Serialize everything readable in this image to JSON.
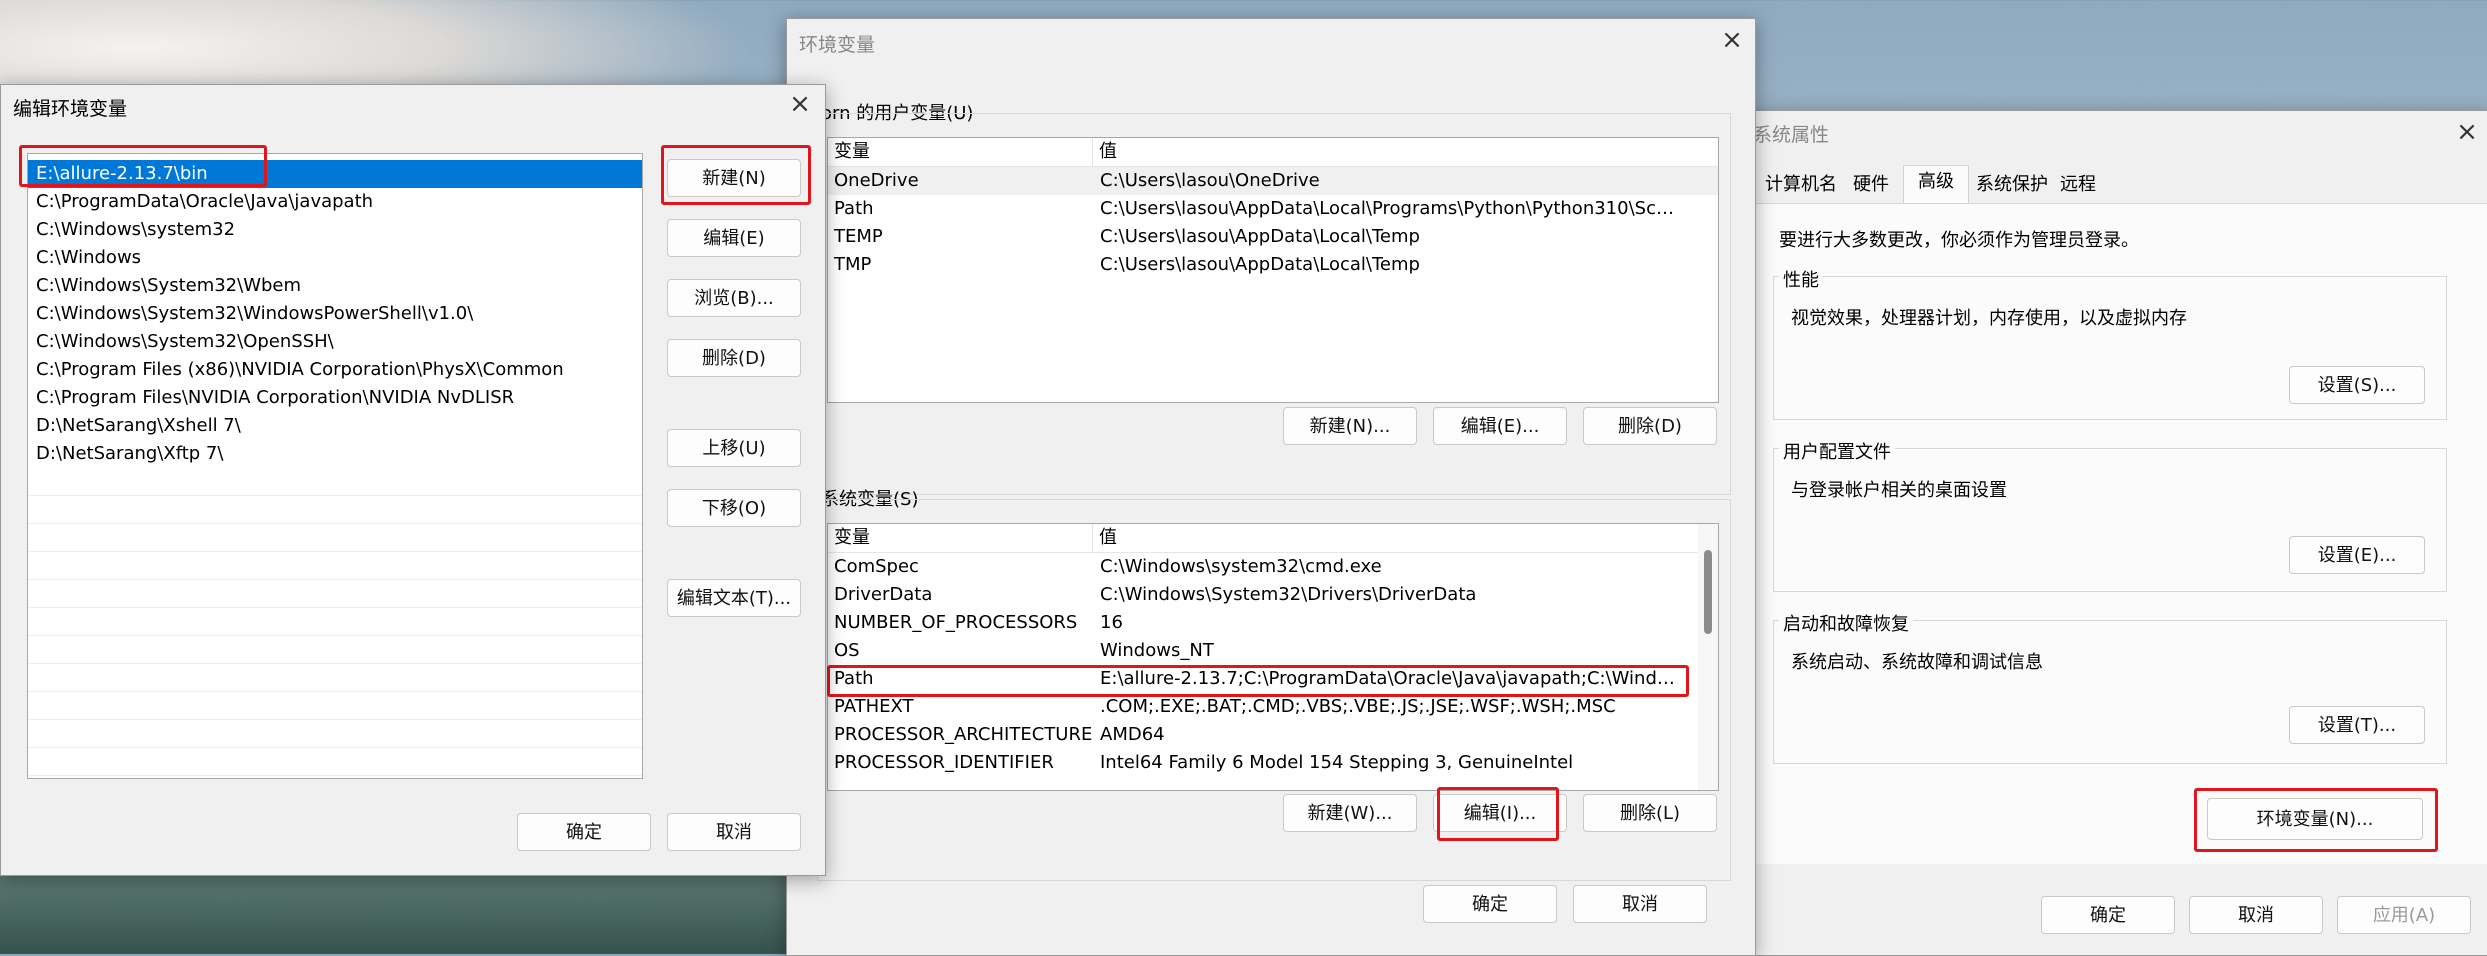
{
  "sysprops": {
    "title": "系统属性",
    "tabs": [
      "计算机名",
      "硬件",
      "高级",
      "系统保护",
      "远程"
    ],
    "admin_note": "要进行大多数更改，你必须作为管理员登录。",
    "performance": {
      "label": "性能",
      "desc": "视觉效果，处理器计划，内存使用，以及虚拟内存",
      "button": "设置(S)..."
    },
    "profiles": {
      "label": "用户配置文件",
      "desc": "与登录帐户相关的桌面设置",
      "button": "设置(E)..."
    },
    "startup": {
      "label": "启动和故障恢复",
      "desc": "系统启动、系统故障和调试信息",
      "button": "设置(T)..."
    },
    "env_button": "环境变量(N)...",
    "ok": "确定",
    "cancel": "取消",
    "apply": "应用(A)"
  },
  "envvars": {
    "title": "环境变量",
    "user_label": "orn 的用户变量(U)",
    "col_var": "变量",
    "col_val": "值",
    "user_rows": [
      {
        "name": "OneDrive",
        "value": "C:\\Users\\lasou\\OneDrive"
      },
      {
        "name": "Path",
        "value": "C:\\Users\\lasou\\AppData\\Local\\Programs\\Python\\Python310\\Scrip..."
      },
      {
        "name": "TEMP",
        "value": "C:\\Users\\lasou\\AppData\\Local\\Temp"
      },
      {
        "name": "TMP",
        "value": "C:\\Users\\lasou\\AppData\\Local\\Temp"
      }
    ],
    "user_buttons": {
      "new": "新建(N)...",
      "edit": "编辑(E)...",
      "delete": "删除(D)"
    },
    "sys_label": "系统变量(S)",
    "sys_rows": [
      {
        "name": "ComSpec",
        "value": "C:\\Windows\\system32\\cmd.exe"
      },
      {
        "name": "DriverData",
        "value": "C:\\Windows\\System32\\Drivers\\DriverData"
      },
      {
        "name": "NUMBER_OF_PROCESSORS",
        "value": "16"
      },
      {
        "name": "OS",
        "value": "Windows_NT"
      },
      {
        "name": "Path",
        "value": "E:\\allure-2.13.7;C:\\ProgramData\\Oracle\\Java\\javapath;C:\\Windows..."
      },
      {
        "name": "PATHEXT",
        "value": ".COM;.EXE;.BAT;.CMD;.VBS;.VBE;.JS;.JSE;.WSF;.WSH;.MSC"
      },
      {
        "name": "PROCESSOR_ARCHITECTURE",
        "value": "AMD64"
      },
      {
        "name": "PROCESSOR_IDENTIFIER",
        "value": "Intel64 Family 6 Model 154 Stepping 3, GenuineIntel"
      }
    ],
    "sys_buttons": {
      "new": "新建(W)...",
      "edit": "编辑(I)...",
      "delete": "删除(L)"
    },
    "ok": "确定",
    "cancel": "取消"
  },
  "editenv": {
    "title": "编辑环境变量",
    "items": [
      "E:\\allure-2.13.7\\bin",
      "C:\\ProgramData\\Oracle\\Java\\javapath",
      "C:\\Windows\\system32",
      "C:\\Windows",
      "C:\\Windows\\System32\\Wbem",
      "C:\\Windows\\System32\\WindowsPowerShell\\v1.0\\",
      "C:\\Windows\\System32\\OpenSSH\\",
      "C:\\Program Files (x86)\\NVIDIA Corporation\\PhysX\\Common",
      "C:\\Program Files\\NVIDIA Corporation\\NVIDIA NvDLISR",
      "D:\\NetSarang\\Xshell 7\\",
      "D:\\NetSarang\\Xftp 7\\"
    ],
    "buttons": {
      "new": "新建(N)",
      "edit": "编辑(E)",
      "browse": "浏览(B)...",
      "delete": "删除(D)",
      "up": "上移(U)",
      "down": "下移(O)",
      "edit_text": "编辑文本(T)..."
    },
    "ok": "确定",
    "cancel": "取消"
  },
  "colors": {
    "selection": "#0078d7",
    "highlight_border": "#e0161b"
  }
}
